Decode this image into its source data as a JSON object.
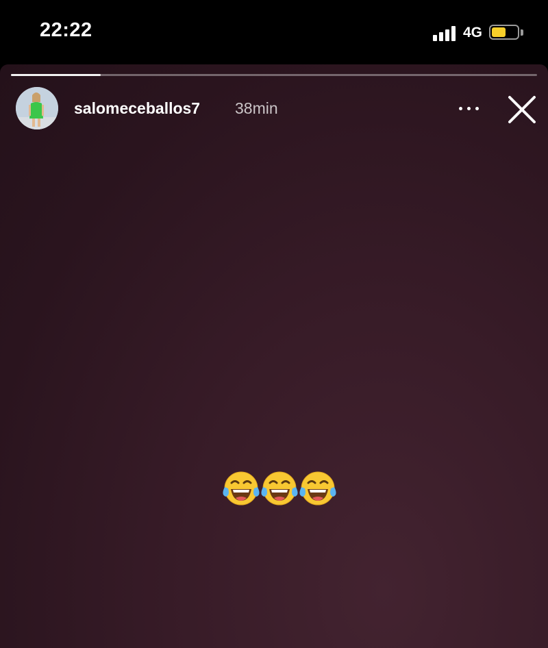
{
  "status_bar": {
    "time": "22:22",
    "network": "4G",
    "signal_bars": 4,
    "battery_level": 0.55,
    "battery_color": "#f7cf2a"
  },
  "story": {
    "progress": 0.17,
    "username": "salomeceballos7",
    "timestamp": "38min",
    "caption_emojis": [
      "face-with-tears-of-joy",
      "face-with-tears-of-joy",
      "face-with-tears-of-joy"
    ],
    "background_color": "#2f1722"
  },
  "icons": {
    "more": "more-options-icon",
    "close": "close-icon"
  }
}
